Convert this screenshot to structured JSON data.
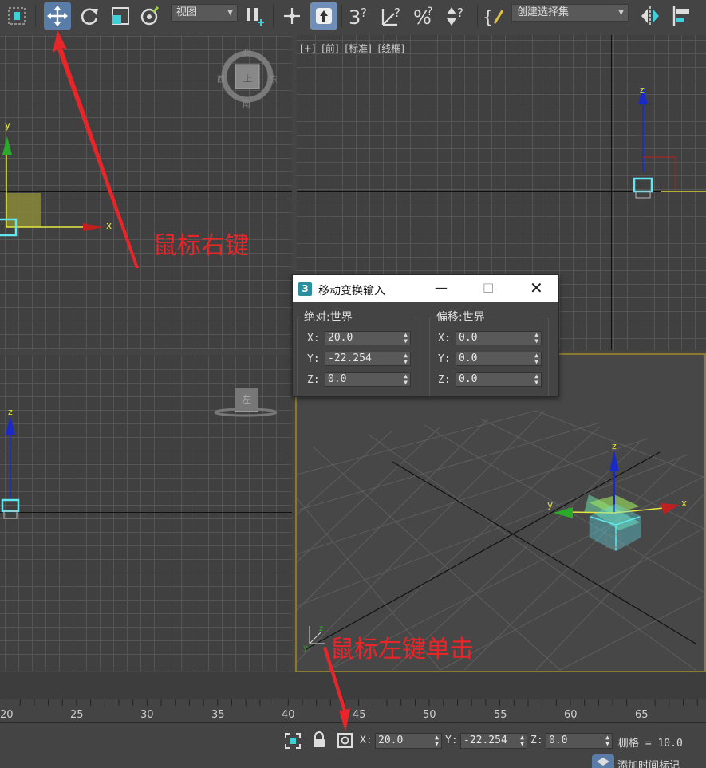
{
  "toolbar": {
    "view_dropdown": "视图",
    "selection_set_dropdown": "创建选择集"
  },
  "viewports": {
    "front_label": "[+] [前] [标准] [线框]",
    "top_viewcube": {
      "north": "北",
      "south": "南",
      "east": "东",
      "west": "西",
      "face": "上"
    },
    "left_viewcube_face": "左"
  },
  "dialog": {
    "title": "移动变换输入",
    "absolute_label": "绝对:世界",
    "offset_label": "偏移:世界",
    "absolute": {
      "x": "20.0",
      "y": "-22.254",
      "z": "0.0"
    },
    "offset": {
      "x": "0.0",
      "y": "0.0",
      "z": "0.0"
    },
    "axis_x": "X:",
    "axis_y": "Y:",
    "axis_z": "Z:"
  },
  "timeline": {
    "ticks": [
      "20",
      "25",
      "30",
      "35",
      "40",
      "45",
      "50",
      "55",
      "60",
      "65"
    ]
  },
  "status": {
    "x_label": "X:",
    "x_value": "20.0",
    "y_label": "Y:",
    "y_value": "-22.254",
    "z_label": "Z:",
    "z_value": "0.0",
    "grid": "栅格 = 10.0",
    "add_time_tag": "添加时间标记"
  },
  "annotations": {
    "right_click": "鼠标右键",
    "left_click": "鼠标左键单击"
  },
  "colors": {
    "accent_active": "#5a7da8",
    "annotation_red": "#e8262a",
    "selection_cyan": "#5fe8f0"
  }
}
